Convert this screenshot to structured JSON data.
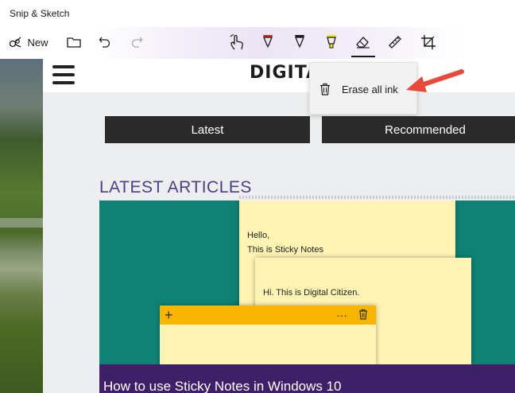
{
  "window": {
    "title": "Snip & Sketch"
  },
  "toolbar": {
    "new_label": "New",
    "icons": [
      "new-snip-icon",
      "open-folder-icon",
      "undo-icon",
      "redo-icon",
      "touch-writing-icon",
      "ballpoint-pen-icon",
      "pencil-icon",
      "highlighter-icon",
      "eraser-icon",
      "ruler-icon",
      "crop-icon"
    ],
    "pen_colors": {
      "ballpoint": "#e2231a",
      "pencil": "#1a1a1a",
      "highlighter": "#f5e800"
    }
  },
  "eraser_menu": {
    "erase_all_label": "Erase all ink",
    "icon": "trash-icon"
  },
  "callout": {
    "color": "#e8493a"
  },
  "capture": {
    "site_logo": "DIGITA",
    "tabs": [
      {
        "label": "Latest"
      },
      {
        "label": "Recommended"
      }
    ],
    "section_heading": "LATEST ARTICLES",
    "article": {
      "title": "How to use Sticky Notes in Windows 10",
      "notes": [
        {
          "lines": [
            "Hello,",
            "This is Sticky Notes"
          ]
        },
        {
          "lines": [
            "Hi. This is Digital Citizen."
          ]
        },
        {
          "bar_plus": "+",
          "bar_more": "···"
        }
      ]
    },
    "colors": {
      "image_bg": "#0f8275",
      "note": "#fff4b3",
      "note_bar": "#f7b500",
      "caption_bg": "#3f2068",
      "heading": "#4f3c86"
    }
  }
}
